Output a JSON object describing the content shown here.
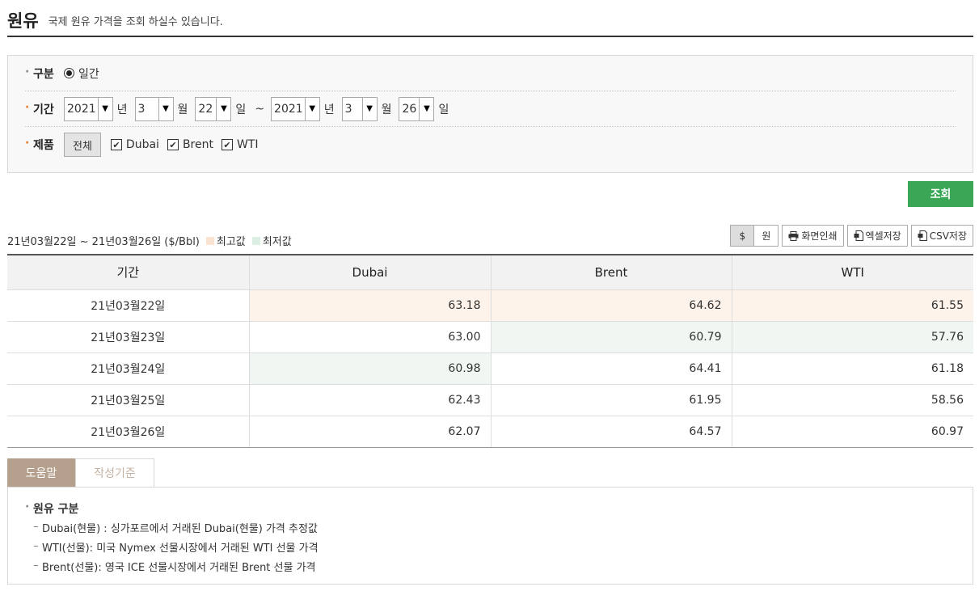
{
  "header": {
    "title": "원유",
    "subtitle": "국제 원유 가격을 조회 하실수 있습니다."
  },
  "search": {
    "type_label": "구분",
    "type_option": "일간",
    "period_label": "기간",
    "start": {
      "year": "2021",
      "month": "3",
      "day": "22"
    },
    "end": {
      "year": "2021",
      "month": "3",
      "day": "26"
    },
    "unit_year": "년",
    "unit_month": "월",
    "unit_day": "일",
    "tilde": "~",
    "product_label": "제품",
    "all_button": "전체",
    "products": [
      "Dubai",
      "Brent",
      "WTI"
    ],
    "dot": "·",
    "checkmark": "✔",
    "arrow": "▼",
    "submit": "조회"
  },
  "result": {
    "period_text": "21년03월22일 ~ 21년03월26일 ($/Bbl)",
    "legend_high": "최고값",
    "legend_low": "최저값",
    "legend_high_color": "#fbe3d2",
    "legend_low_color": "#dcefe3",
    "unit_dollar": "$",
    "unit_won": "원",
    "print": "화면인쇄",
    "excel": "엑셀저장",
    "csv": "CSV저장",
    "print_icon": "printer-icon",
    "excel_icon": "excel-file-icon",
    "csv_icon": "csv-file-icon"
  },
  "table": {
    "headers": [
      "기간",
      "Dubai",
      "Brent",
      "WTI"
    ],
    "rows": [
      [
        "21년03월22일",
        "63.18",
        "64.62",
        "61.55"
      ],
      [
        "21년03월23일",
        "63.00",
        "60.79",
        "57.76"
      ],
      [
        "21년03월24일",
        "60.98",
        "64.41",
        "61.18"
      ],
      [
        "21년03월25일",
        "62.43",
        "61.95",
        "58.56"
      ],
      [
        "21년03월26일",
        "62.07",
        "64.57",
        "60.97"
      ]
    ]
  },
  "help": {
    "tab_help": "도움말",
    "tab_criteria": "작성기준",
    "title": "원유 구분",
    "items": [
      "⁻ Dubai(현물) : 싱가포르에서 거래된 Dubai(현물) 가격 추정값",
      "⁻ WTI(선물): 미국 Nymex 선물시장에서 거래된 WTI 선물 가격",
      "⁻ Brent(선물): 영국 ICE 선물시장에서 거래된 Brent 선물 가격"
    ]
  }
}
